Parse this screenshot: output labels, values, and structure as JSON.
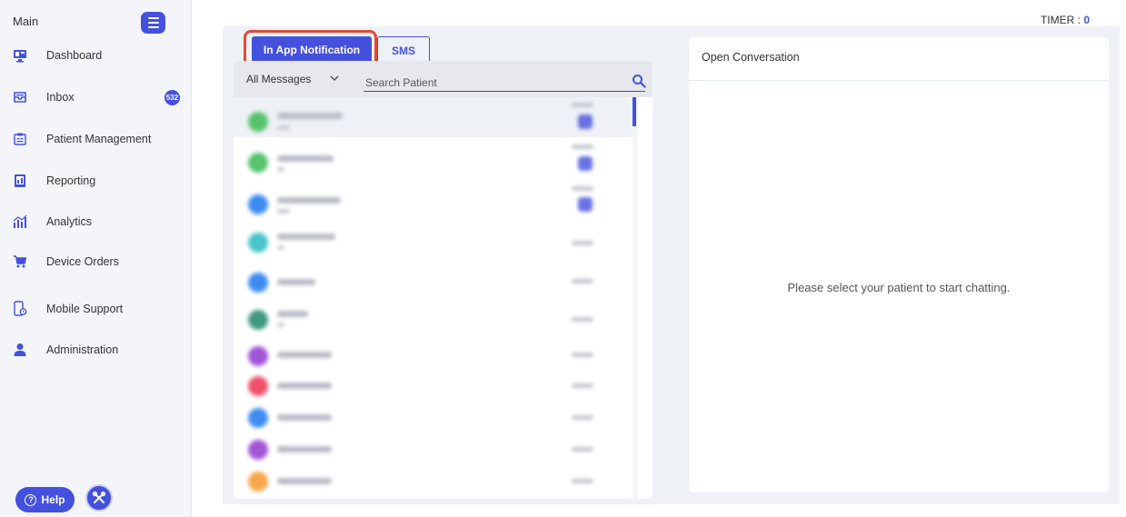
{
  "sidebar": {
    "heading": "Main",
    "items": [
      {
        "label": "Dashboard",
        "icon": "monitor-icon"
      },
      {
        "label": "Inbox",
        "icon": "inbox-icon",
        "badge": "532"
      },
      {
        "label": "Patient Management",
        "icon": "patient-management-icon"
      },
      {
        "label": "Reporting",
        "icon": "reporting-icon"
      },
      {
        "label": "Analytics",
        "icon": "analytics-icon"
      },
      {
        "label": "Device Orders",
        "icon": "cart-icon"
      },
      {
        "label": "Mobile Support",
        "icon": "mobile-support-icon"
      },
      {
        "label": "Administration",
        "icon": "user-icon"
      }
    ],
    "help_label": "Help"
  },
  "header": {
    "timer_label": "TIMER :",
    "timer_value": "0"
  },
  "tabs": {
    "in_app": "In App Notification",
    "sms": "SMS"
  },
  "filter": {
    "selected": "All Messages",
    "search_placeholder": "Search Patient"
  },
  "conversation": {
    "title": "Open Conversation",
    "empty_message": "Please select your patient to start chatting."
  },
  "colors": {
    "accent": "#4451de",
    "highlight": "#e24a35"
  }
}
